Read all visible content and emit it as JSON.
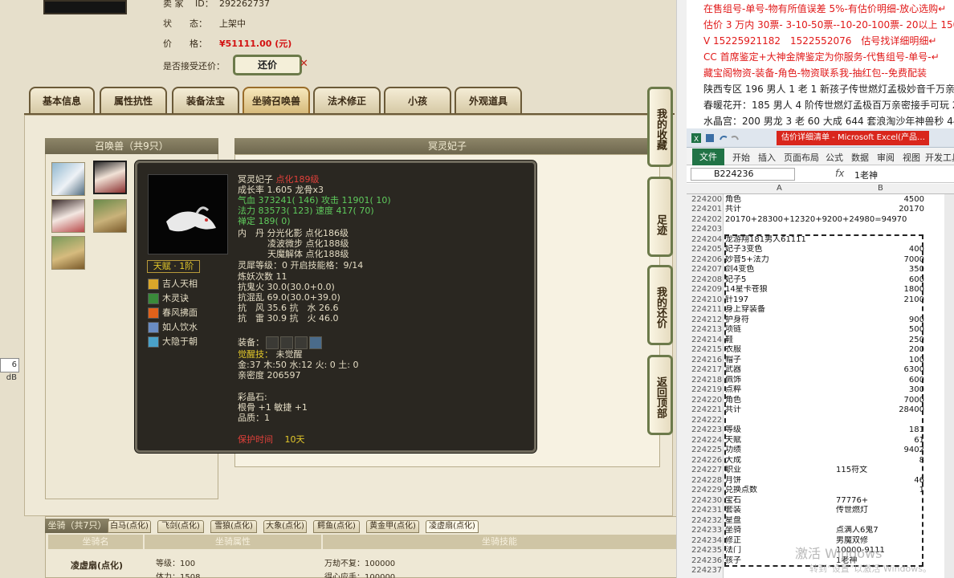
{
  "seller": {
    "id_label": "卖 家　 ID：",
    "id_value": "292262737",
    "status_label": "状　　态：",
    "status_value": "上架中",
    "price_label": "价　　格：",
    "price_value": "¥51111.00 (元)",
    "bargain_label": "是否接受还价：",
    "bargain_button": "还价",
    "close_mark": "✕"
  },
  "tabs": [
    "基本信息",
    "属性抗性",
    "装备法宝",
    "坐骑召唤兽",
    "法术修正",
    "小孩",
    "外观道具"
  ],
  "active_tab": "坐骑召唤兽",
  "summon_panel": {
    "title": "召唤兽（共9只）",
    "detail_title": "冥灵妃子"
  },
  "tooltip": {
    "name": "冥灵妃子",
    "name_suffix": "点化189级",
    "growth": "成长率 1.605 龙骨x3",
    "hp": "气血 373241( 146) 攻击 11901( 10)",
    "mp": "法力 83573( 123) 速度 417( 70)",
    "ding": "禅定 189( 0)",
    "neidan1": "内　丹 分光化影 点化186级",
    "neidan2": "凌波微步 点化188级",
    "neidan3": "天魔解体 点化188级",
    "lingxi": "灵犀等级：0 开启技能格：9/14",
    "lianyao": "炼妖次数 11",
    "kanggui": "抗鬼火 30.0(30.0+0.0)",
    "kanghun": "抗混乱 69.0(30.0+39.0)",
    "kangfeng": "抗　风 35.6 抗　水 26.6",
    "kanglei": "抗　雷 30.9 抗　火 46.0",
    "talent": "天赋 · 1阶",
    "skills": [
      "吉人天相",
      "木灵诀",
      "春风拂面",
      "如人饮水",
      "大隐于朝"
    ],
    "equip_label": "装备：",
    "awaken_label": "觉醒技：",
    "awaken_value": "未觉醒",
    "elements": "金:37 木:50 水:12 火: 0 土: 0",
    "intimacy": "亲密度 206597",
    "crystal_label": "彩晶石:",
    "crystal_bone": "根骨 +1 敏捷 +1",
    "crystal_quality": "品质：1",
    "protect_label": "保护时间",
    "protect_value": "10天"
  },
  "side_buttons": [
    "我的收藏",
    "足迹",
    "我的还价",
    "返回顶部"
  ],
  "mount": {
    "title": "坐骑（共7只）",
    "tabs": [
      "白马(点化)",
      "飞剑(点化)",
      "雪狼(点化)",
      "大象(点化)",
      "鳄鱼(点化)",
      "黄金甲(点化)",
      "凌虚扇(点化)"
    ],
    "active_tab": "凌虚扇(点化)",
    "col_name": "坐骑名",
    "col_attr": "坐骑属性",
    "col_skill": "坐骑技能",
    "name": "凌虚扇(点化)",
    "level": "等级：100",
    "stamina": "体力：1508",
    "skill1": "万劫不复：100000",
    "skill2": "得心应手：100000"
  },
  "db_label": "6 dB",
  "notes": [
    "在售组号-单号-物有所值误差 5%-有估价明细-放心选购↵",
    "估价 3 万内 30票- 3-10-50票--10-20-100票- 20以上 150票-1票",
    "V 15225921182　1522552076　估号找详细明细↵",
    "CC 首席鉴定+大神金牌鉴定为你服务-代售组号-单号-↵",
    "藏宝阁物资-装备-角色-物资联系我-抽红包--免费配装",
    "陕西专区 196 男人 1 老 1 新孩子传世燃灯孟极妙音千万亲密 4",
    "春暖花开：185 男人 4 阶传世燃灯孟极百万亲密接手可玩 2800",
    "水晶宫：200 男龙 3 老 60 大成 644 套浪淘沙年神兽秒 440000-"
  ],
  "excel": {
    "title": "估价详细清单 - Microsoft Excel(产品…",
    "ribbon": [
      "开始",
      "插入",
      "页面布局",
      "公式",
      "数据",
      "审阅",
      "视图",
      "开发工具"
    ],
    "file_tab": "文件",
    "name_box": "B224236",
    "fx": "fx",
    "formula_value": "1老神",
    "col_a": "A",
    "col_b": "B",
    "rows": [
      {
        "n": "224200",
        "a": "角色",
        "b": "4500"
      },
      {
        "n": "224201",
        "a": "共计",
        "b": "20170"
      },
      {
        "n": "224202",
        "a": "20170+28300+12320+9200+24980=94970",
        "b": ""
      },
      {
        "n": "224203",
        "a": "",
        "b": ""
      },
      {
        "n": "224204",
        "a": "龙游翔181男人61111",
        "b": ""
      },
      {
        "n": "224205",
        "a": "妃子3变色",
        "b": "400"
      },
      {
        "n": "224206",
        "a": "妙音5+法力",
        "b": "7000"
      },
      {
        "n": "224207",
        "a": "剑4变色",
        "b": "350"
      },
      {
        "n": "224208",
        "a": "妃子5",
        "b": "600"
      },
      {
        "n": "224209",
        "a": "14星卡苍狼",
        "b": "1800"
      },
      {
        "n": "224210",
        "a": "针197",
        "b": "2100"
      },
      {
        "n": "224211",
        "a": "身上穿装备",
        "b": ""
      },
      {
        "n": "224212",
        "a": "护身符",
        "b": "900"
      },
      {
        "n": "224213",
        "a": "项链",
        "b": "500"
      },
      {
        "n": "224214",
        "a": "鞋",
        "b": "250"
      },
      {
        "n": "224215",
        "a": "衣服",
        "b": "200"
      },
      {
        "n": "224216",
        "a": "帽子",
        "b": "100"
      },
      {
        "n": "224217",
        "a": "武器",
        "b": "6300"
      },
      {
        "n": "224218",
        "a": "佩饰",
        "b": "600"
      },
      {
        "n": "224219",
        "a": "点粹",
        "b": "300"
      },
      {
        "n": "224220",
        "a": "角色",
        "b": "7000"
      },
      {
        "n": "224221",
        "a": "共计",
        "b": "28400"
      },
      {
        "n": "224222",
        "a": "",
        "b": ""
      },
      {
        "n": "224223",
        "a": "等级",
        "b": "181"
      },
      {
        "n": "224224",
        "a": "天赋",
        "b": "61"
      },
      {
        "n": "224225",
        "a": "功绩",
        "b": "9402"
      },
      {
        "n": "224226",
        "a": "大成",
        "b": "8"
      },
      {
        "n": "224227",
        "a": "职业",
        "b": "115符文"
      },
      {
        "n": "224228",
        "a": "月饼",
        "b": "46"
      },
      {
        "n": "224229",
        "a": "兑换点数",
        "b": "1"
      },
      {
        "n": "224230",
        "a": "宝石",
        "b": "77776+"
      },
      {
        "n": "224231",
        "a": "套装",
        "b": "传世燃灯"
      },
      {
        "n": "224232",
        "a": "星盘",
        "b": ""
      },
      {
        "n": "224233",
        "a": "坐骑",
        "b": "点满人6鬼7"
      },
      {
        "n": "224234",
        "a": "修正",
        "b": "男魔双修"
      },
      {
        "n": "224235",
        "a": "法门",
        "b": "10000-9111"
      },
      {
        "n": "224236",
        "a": "孩子",
        "b": "1老神"
      },
      {
        "n": "224237",
        "a": "",
        "b": ""
      }
    ]
  },
  "watermark": "激活 Windows",
  "watermark_sub": "转到“设置”以激活 Windows。",
  "colors": {
    "price": "#d31212",
    "excel_green": "#217346",
    "excel_title_red": "#d9261c",
    "tooltip_bg": "#2a2721"
  }
}
